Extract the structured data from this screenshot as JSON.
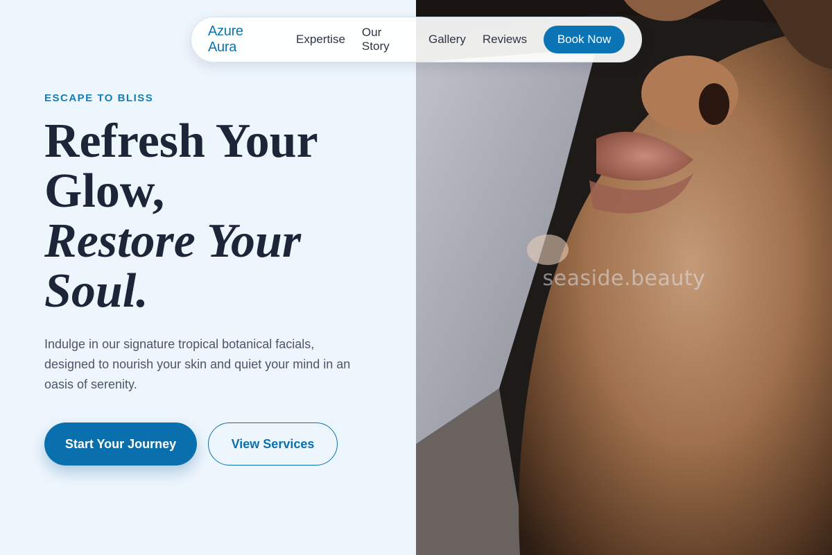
{
  "nav": {
    "brand": "Azure Aura",
    "links": [
      "Expertise",
      "Our Story",
      "Gallery",
      "Reviews"
    ],
    "cta": "Book Now"
  },
  "hero": {
    "eyebrow": "ESCAPE TO BLISS",
    "headline_line1": "Refresh Your",
    "headline_line2": "Glow,",
    "headline_italic1": "Restore Your",
    "headline_italic2": "Soul.",
    "description": "Indulge in our signature tropical botanical facials, designed to nourish your skin and quiet your mind in an oasis of serenity.",
    "primary_button": "Start Your Journey",
    "secondary_button": "View Services"
  },
  "image": {
    "watermark": "seaside.beauty"
  },
  "colors": {
    "brand": "#0a74b4",
    "background": "#eef6fd",
    "headline": "#1c2638"
  }
}
